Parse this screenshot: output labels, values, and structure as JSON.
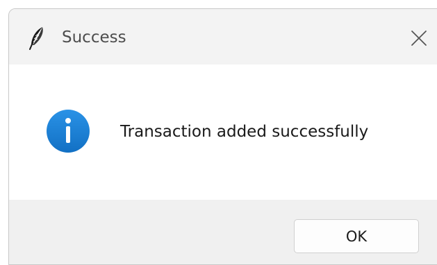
{
  "window": {
    "title": "Success",
    "title_icon": "feather-icon",
    "close_icon": "close-icon"
  },
  "dialog": {
    "icon": "info-icon",
    "message": "Transaction added successfully",
    "ok_label": "OK"
  },
  "colors": {
    "info_blue": "#1a7fd4",
    "titlebar_bg": "#f3f3f3",
    "content_bg": "#ffffff",
    "footer_bg": "#f0f0f0"
  }
}
